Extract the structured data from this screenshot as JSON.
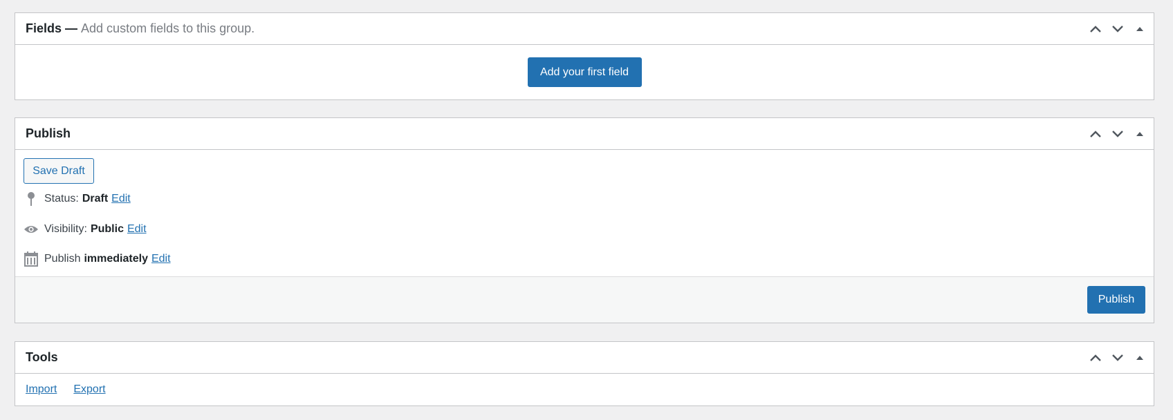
{
  "fields_box": {
    "title": "Fields —",
    "description": "Add custom fields to this group.",
    "add_button": "Add your first field"
  },
  "publish_box": {
    "title": "Publish",
    "save_draft": "Save Draft",
    "status": {
      "label": "Status:",
      "value": "Draft",
      "edit": "Edit"
    },
    "visibility": {
      "label": "Visibility:",
      "value": "Public",
      "edit": "Edit"
    },
    "schedule": {
      "label": "Publish",
      "value": "immediately",
      "edit": "Edit"
    },
    "publish_button": "Publish"
  },
  "tools_box": {
    "title": "Tools",
    "links": [
      "Import",
      "Export"
    ]
  },
  "icons": {
    "move_up": "chevron-up-icon",
    "move_down": "chevron-down-icon",
    "toggle": "caret-up-icon",
    "status": "pin-icon",
    "visibility": "eye-icon",
    "schedule": "calendar-icon"
  },
  "colors": {
    "background": "#f0f0f1",
    "primary": "#2271b1",
    "border": "#c3c4c7",
    "footer_bg": "#f6f7f7",
    "icon": "#8c8f94"
  }
}
